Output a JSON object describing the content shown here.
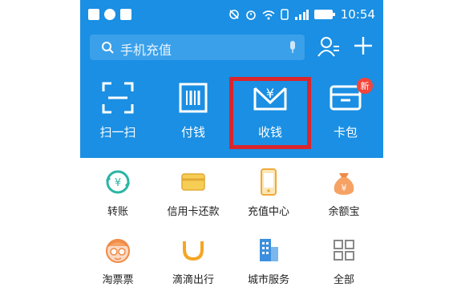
{
  "status_bar": {
    "time": "10:54"
  },
  "search": {
    "placeholder": "手机充值"
  },
  "features": [
    {
      "label": "扫一扫",
      "icon": "scan-icon"
    },
    {
      "label": "付钱",
      "icon": "barcode-icon"
    },
    {
      "label": "收钱",
      "icon": "receive-money-icon"
    },
    {
      "label": "卡包",
      "icon": "card-wallet-icon",
      "badge": "新"
    }
  ],
  "services": [
    {
      "label": "转账",
      "icon": "transfer-icon"
    },
    {
      "label": "信用卡还款",
      "icon": "credit-card-icon"
    },
    {
      "label": "充值中心",
      "icon": "phone-recharge-icon"
    },
    {
      "label": "余额宝",
      "icon": "money-bag-icon"
    },
    {
      "label": "淘票票",
      "icon": "taopiaopiao-icon"
    },
    {
      "label": "滴滴出行",
      "icon": "didi-icon"
    },
    {
      "label": "城市服务",
      "icon": "city-service-icon"
    },
    {
      "label": "全部",
      "icon": "all-grid-icon"
    }
  ],
  "colors": {
    "header_blue": "#1a8fe3",
    "highlight_red": "#d9262c"
  }
}
